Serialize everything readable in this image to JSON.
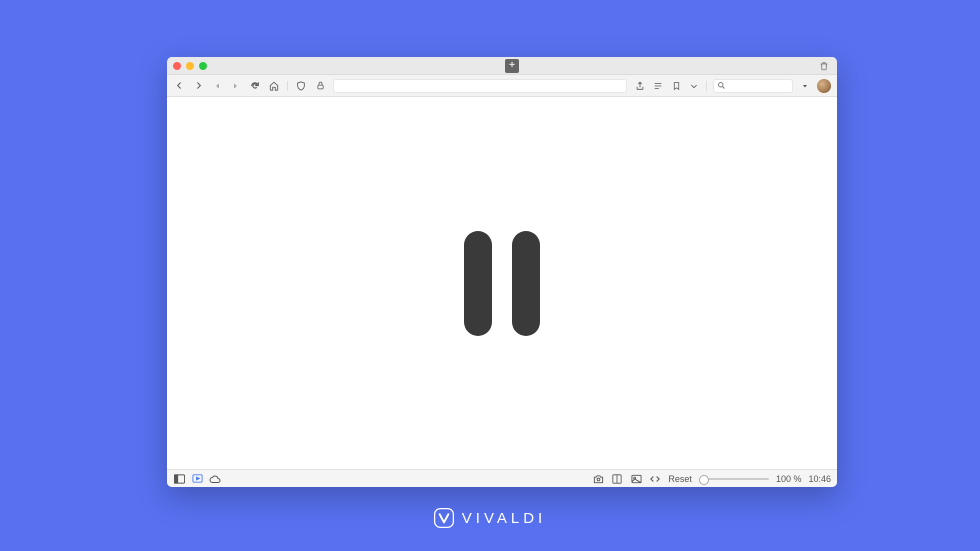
{
  "brand": {
    "name": "VIVALDI"
  },
  "statusbar": {
    "reset_label": "Reset",
    "zoom_label": "100 %",
    "clock": "10:46"
  },
  "colors": {
    "background": "#5771f0",
    "pause_bar": "#3a3a3a"
  }
}
